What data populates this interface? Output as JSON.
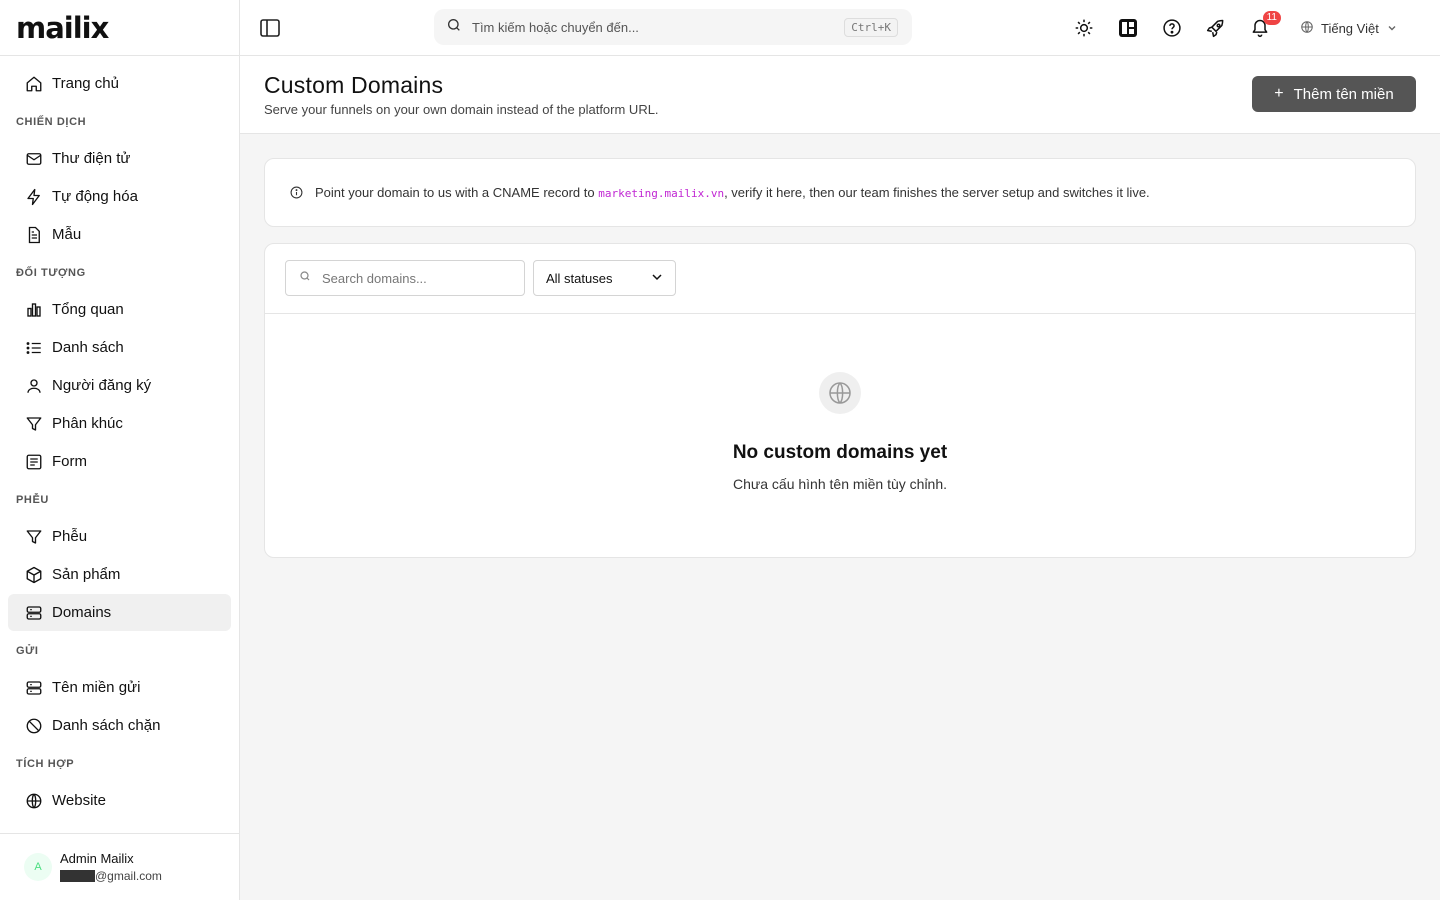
{
  "brand": {
    "logo": "mailix"
  },
  "sidebar": {
    "home": "Trang chủ",
    "sections": {
      "campaigns": "CHIẾN DỊCH",
      "audience": "ĐỐI TƯỢNG",
      "funnels": "PHỄU",
      "send": "GỬI",
      "integrations": "TÍCH HỢP"
    },
    "items": {
      "emails": "Thư điện tử",
      "automation": "Tự động hóa",
      "templates": "Mẫu",
      "overview": "Tổng quan",
      "lists": "Danh sách",
      "subscribers": "Người đăng ký",
      "segments": "Phân khúc",
      "forms": "Form",
      "funnels": "Phễu",
      "products": "Sản phẩm",
      "domains": "Domains",
      "sending_domains": "Tên miền gửi",
      "blocklist": "Danh sách chặn",
      "website": "Website"
    },
    "active": "domains",
    "user": {
      "avatar_initial": "A",
      "name": "Admin Mailix",
      "email_domain": "@gmail.com"
    }
  },
  "topbar": {
    "search_placeholder": "Tìm kiếm hoặc chuyển đến...",
    "shortcut": "Ctrl+K",
    "notifications_count": "11",
    "language": "Tiếng Việt"
  },
  "page": {
    "title": "Custom Domains",
    "subtitle": "Serve your funnels on your own domain instead of the platform URL.",
    "add_button": "Thêm tên miền"
  },
  "info": {
    "text_before": "Point your domain to us with a CNAME record to ",
    "cname_target": "marketing.mailix.vn",
    "text_after": ", verify it here, then our team finishes the server setup and switches it live."
  },
  "filters": {
    "search_placeholder": "Search domains...",
    "status_selected": "All statuses"
  },
  "empty_state": {
    "title": "No custom domains yet",
    "subtitle": "Chưa cấu hình tên miền tùy chỉnh."
  },
  "colors": {
    "accent_button": "#555555",
    "badge": "#ef4444",
    "code": "#c026d3",
    "active_nav": "#f0f0f0"
  }
}
